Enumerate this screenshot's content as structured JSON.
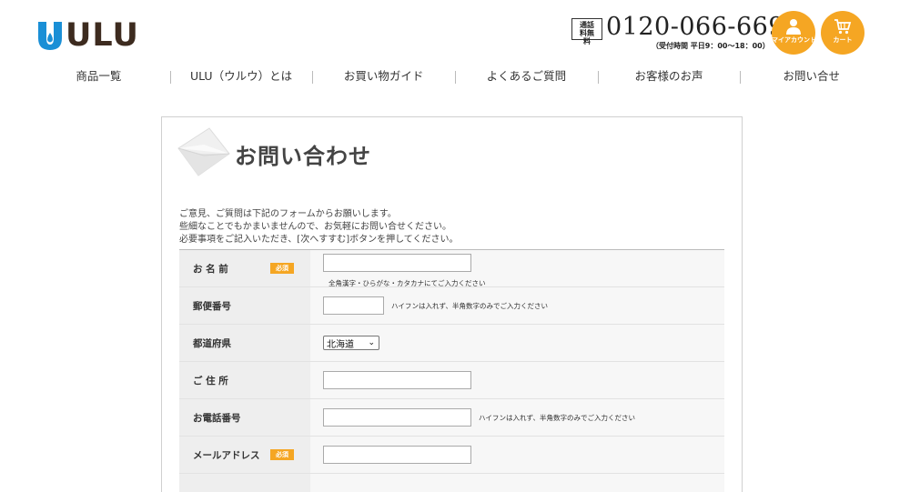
{
  "header": {
    "logo_text": "ULU",
    "tel_badge": "通話料無料",
    "tel_number": "0120-066-669",
    "tel_hours": "（受付時間  平日9：00～18：00）",
    "account_label": "マイアカウント",
    "cart_label": "カート",
    "accent_color": "#f5a623",
    "logo_color": "#1a8fd6"
  },
  "nav": {
    "items": [
      "商品一覧",
      "ULU（ウルウ）とは",
      "お買い物ガイド",
      "よくあるご質問",
      "お客様のお声",
      "お問い合せ"
    ]
  },
  "page": {
    "title": "お問い合わせ",
    "intro": [
      "ご意見、ご質問は下記のフォームからお願いします。",
      "些細なことでもかまいませんので、お気軽にお問い合せください。",
      "必要事項をご記入いただき、[次へすすむ]ボタンを押してください。"
    ]
  },
  "form": {
    "required_badge": "必須",
    "name_label": "お 名 前",
    "name_note": "全角漢字・ひらがな・カタカナにてご入力ください",
    "zip_label": "郵便番号",
    "zip_note": "ハイフンは入れず、半角数字のみでご入力ください",
    "pref_label": "都道府県",
    "pref_value": "北海道",
    "address_label": "ご 住 所",
    "phone_label": "お電話番号",
    "phone_note": "ハイフンは入れず、半角数字のみでご入力ください",
    "email_label": "メールアドレス"
  }
}
